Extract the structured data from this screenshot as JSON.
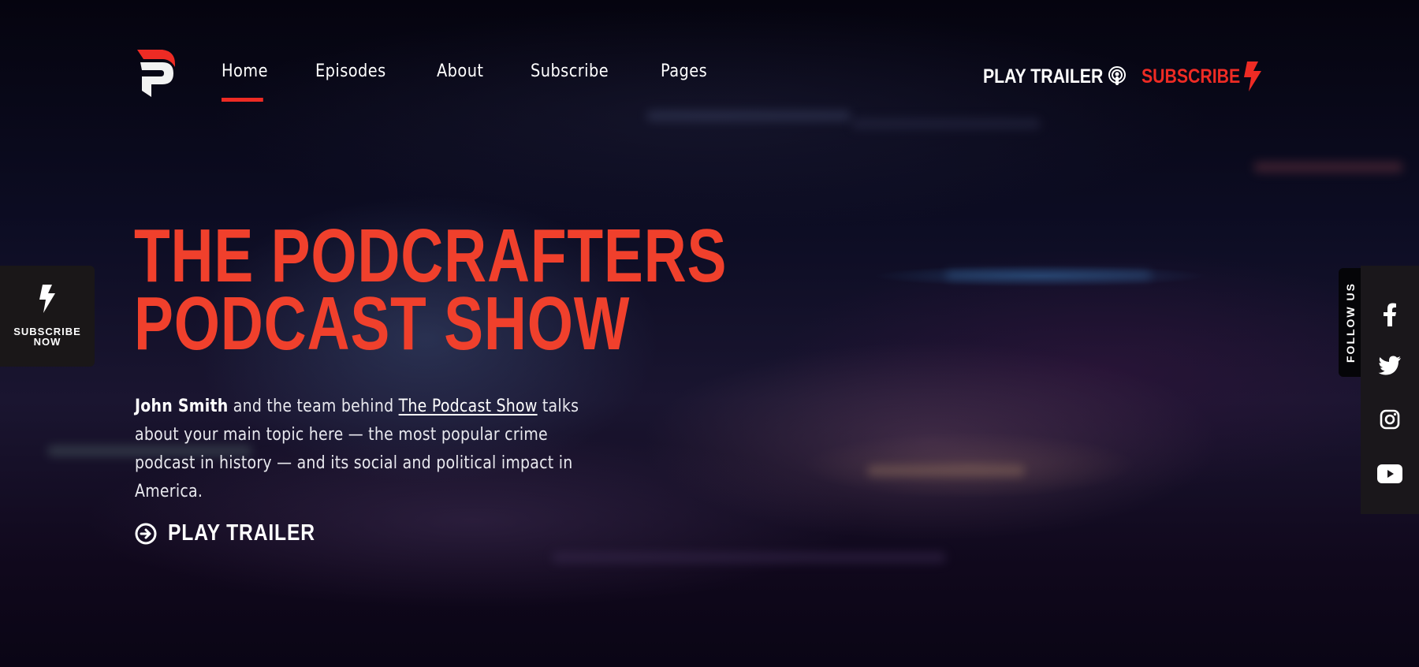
{
  "brand": {
    "logo_alt": "Podcrafters logo",
    "accent": "#ee2b24"
  },
  "nav": {
    "items": [
      {
        "label": "Home",
        "active": true
      },
      {
        "label": "Episodes"
      },
      {
        "label": "About"
      },
      {
        "label": "Subscribe"
      },
      {
        "label": "Pages"
      }
    ]
  },
  "header_actions": {
    "play_trailer": {
      "label": "PLAY TRAILER",
      "icon": "podcast-icon"
    },
    "subscribe": {
      "label": "SUBSCRIBE",
      "icon": "lightning-bolt-icon"
    }
  },
  "sidebar_left": {
    "subscribe_now_line1": "SUBSCRIBE",
    "subscribe_now_line2": "NOW",
    "icon": "lightning-bolt-icon"
  },
  "hero": {
    "title_line1": "THE PODCRAFTERS",
    "title_line2": "PODCAST SHOW",
    "text_bold": "John Smith",
    "text_part1": " and the team behind ",
    "text_link": "The Podcast Show",
    "text_part2": " talks about your main topic here — the most popular crime podcast in history — and its social and political impact in America.",
    "cta_label": "PLAY TRAILER",
    "cta_icon": "arrow-circle-right-icon"
  },
  "social": {
    "label": "FOLLOW US",
    "items": [
      {
        "name": "facebook-icon"
      },
      {
        "name": "twitter-icon"
      },
      {
        "name": "instagram-icon"
      },
      {
        "name": "youtube-icon"
      }
    ]
  }
}
